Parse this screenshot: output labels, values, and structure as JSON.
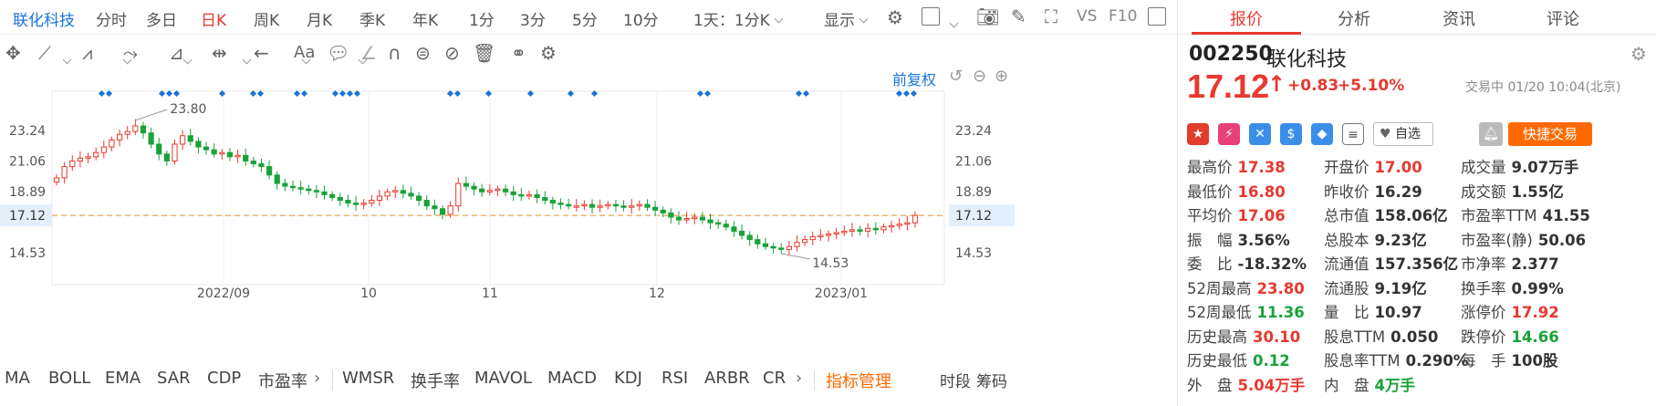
{
  "toolbar": {
    "stock_name": "联化科技",
    "tabs": [
      "分时",
      "多日",
      "日K",
      "周K",
      "月K",
      "季K",
      "年K",
      "1分",
      "3分",
      "5分",
      "10分",
      "1天：1分K",
      "显示"
    ],
    "active_tab": "日K",
    "vs_label": "VS",
    "f10_label": "F10",
    "adjust_label": "前复权"
  },
  "chart_data": {
    "type": "candlestick",
    "y_ticks": [
      "23.24",
      "21.06",
      "18.89",
      "17.12",
      "14.53"
    ],
    "y_tick_values": [
      23.24,
      21.06,
      18.89,
      17.12,
      14.53
    ],
    "x_labels": [
      "2022/09",
      "10",
      "11",
      "12",
      "2023/01"
    ],
    "current_price_line": 17.12,
    "high_annotation": "23.80",
    "low_annotation": "14.53",
    "close_path": [
      19.8,
      20.6,
      21.0,
      21.2,
      21.3,
      21.6,
      22.0,
      22.5,
      22.9,
      23.1,
      23.5,
      23.0,
      22.2,
      21.5,
      21.0,
      22.2,
      22.8,
      22.4,
      22.0,
      21.8,
      21.5,
      21.6,
      21.3,
      21.4,
      21.0,
      20.8,
      20.6,
      20.0,
      19.4,
      19.2,
      19.1,
      19.0,
      18.9,
      18.8,
      18.6,
      18.4,
      18.2,
      18.0,
      17.9,
      18.0,
      18.2,
      18.5,
      18.8,
      18.9,
      18.7,
      18.5,
      18.2,
      17.8,
      17.6,
      17.2,
      17.8,
      19.4,
      19.2,
      19.0,
      18.8,
      18.9,
      19.0,
      18.8,
      18.6,
      18.5,
      18.6,
      18.4,
      18.2,
      18.0,
      17.9,
      17.8,
      17.8,
      17.9,
      17.7,
      17.8,
      17.9,
      17.8,
      17.7,
      17.8,
      17.9,
      17.7,
      17.5,
      17.3,
      17.0,
      16.8,
      16.9,
      17.0,
      16.8,
      16.6,
      16.5,
      16.3,
      16.0,
      15.7,
      15.4,
      15.1,
      14.9,
      14.8,
      14.7,
      14.9,
      15.2,
      15.4,
      15.6,
      15.7,
      15.8,
      15.9,
      16.0,
      16.1,
      16.0,
      16.2,
      16.1,
      16.3,
      16.4,
      16.5,
      16.6,
      17.12
    ]
  },
  "indicators": [
    "MA",
    "BOLL",
    "EMA",
    "SAR",
    "CDP",
    "市盈率",
    "WMSR",
    "换手率",
    "MAVOL",
    "MACD",
    "KDJ",
    "RSI",
    "ARBR",
    "CR"
  ],
  "indicator_manage": "指标管理",
  "bottom_right": [
    "时段",
    "筹码"
  ],
  "panel": {
    "tabs": [
      "报价",
      "分析",
      "资讯",
      "评论"
    ],
    "code": "002250",
    "name": "联化科技",
    "price": "17.12",
    "change": "+0.83",
    "change_pct": "+5.10%",
    "status_time": "交易中 01/20 10:04(北京)",
    "watch_label": "自选",
    "quick_trade": "快捷交易",
    "stats": [
      [
        {
          "l": "最高价",
          "v": "17.38",
          "c": "red"
        },
        {
          "l": "开盘价",
          "v": "17.00",
          "c": "red"
        },
        {
          "l": "成交量",
          "v": "9.07万手",
          "c": ""
        }
      ],
      [
        {
          "l": "最低价",
          "v": "16.80",
          "c": "red"
        },
        {
          "l": "昨收价",
          "v": "16.29",
          "c": ""
        },
        {
          "l": "成交额",
          "v": "1.55亿",
          "c": ""
        }
      ],
      [
        {
          "l": "平均价",
          "v": "17.06",
          "c": "red"
        },
        {
          "l": "总市值",
          "v": "158.06亿",
          "c": ""
        },
        {
          "l": "市盈率TTM",
          "v": "41.55",
          "c": ""
        }
      ],
      [
        {
          "l": "振　幅",
          "v": "3.56%",
          "c": ""
        },
        {
          "l": "总股本",
          "v": "9.23亿",
          "c": ""
        },
        {
          "l": "市盈率(静)",
          "v": "50.06",
          "c": ""
        }
      ],
      [
        {
          "l": "委　比",
          "v": "-18.32%",
          "c": ""
        },
        {
          "l": "流通值",
          "v": "157.356亿",
          "c": ""
        },
        {
          "l": "市净率",
          "v": "2.377",
          "c": ""
        }
      ],
      [
        {
          "l": "52周最高",
          "v": "23.80",
          "c": "red"
        },
        {
          "l": "流通股",
          "v": "9.19亿",
          "c": ""
        },
        {
          "l": "换手率",
          "v": "0.99%",
          "c": ""
        }
      ],
      [
        {
          "l": "52周最低",
          "v": "11.36",
          "c": "green"
        },
        {
          "l": "量　比",
          "v": "10.97",
          "c": ""
        },
        {
          "l": "涨停价",
          "v": "17.92",
          "c": "red"
        }
      ],
      [
        {
          "l": "历史最高",
          "v": "30.10",
          "c": "red"
        },
        {
          "l": "股息TTM",
          "v": "0.050",
          "c": ""
        },
        {
          "l": "跌停价",
          "v": "14.66",
          "c": "green"
        }
      ],
      [
        {
          "l": "历史最低",
          "v": "0.12",
          "c": "green"
        },
        {
          "l": "股息率TTM",
          "v": "0.290%",
          "c": ""
        },
        {
          "l": "每　手",
          "v": "100股",
          "c": ""
        }
      ],
      [
        {
          "l": "外　盘",
          "v": "5.04万手",
          "c": "red"
        },
        {
          "l": "内　盘",
          "v": "4万手",
          "c": "green"
        },
        {
          "l": "",
          "v": "",
          "c": ""
        }
      ]
    ]
  }
}
